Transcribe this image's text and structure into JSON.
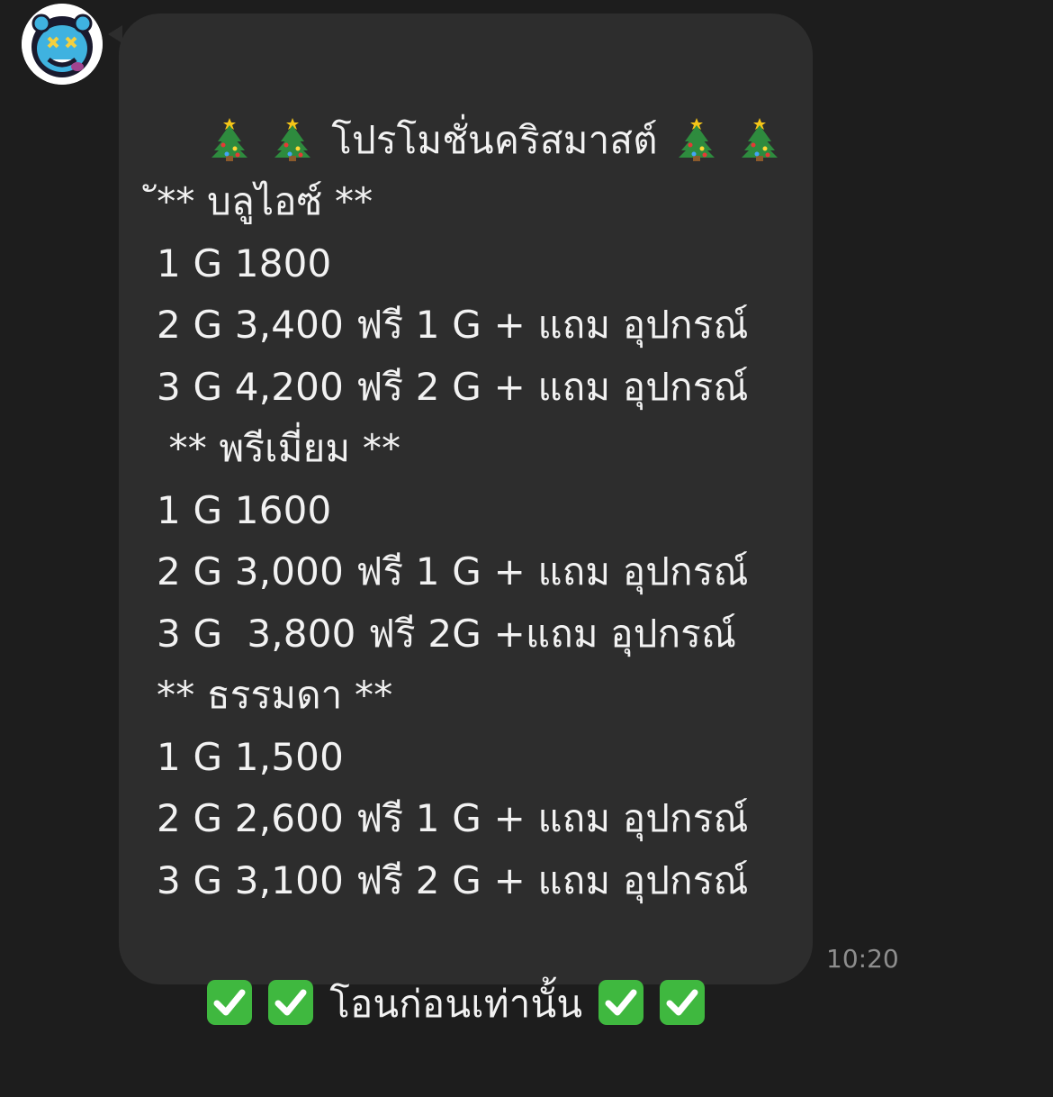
{
  "message": {
    "title_text": "โปรโมชั่นคริสมาสต์",
    "title_left_icons": [
      "christmas-tree-icon",
      "christmas-tree-icon"
    ],
    "title_right_icons": [
      "christmas-tree-icon",
      "christmas-tree-icon"
    ],
    "lines": [
      "ั** บลูไอซ์ **",
      "1 G 1800",
      "2 G 3,400 ฟรี 1 G + แถม อุปกรณ์",
      "3 G 4,200 ฟรี 2 G + แถม อุปกรณ์",
      " ** พรีเมี่ยม **",
      "1 G 1600",
      "2 G 3,000 ฟรี 1 G + แถม อุปกรณ์",
      "3 G  3,800 ฟรี 2G +แถม อุปกรณ์",
      "** ธรรมดา **",
      "1 G 1,500",
      "2 G 2,600 ฟรี 1 G + แถม อุปกรณ์",
      "3 G 3,100 ฟรี 2 G + แถม อุปกรณ์"
    ],
    "footer_text": "โอนก่อนเท่านั้น",
    "footer_left_icons": [
      "check-mark-icon",
      "check-mark-icon"
    ],
    "footer_right_icons": [
      "check-mark-icon",
      "check-mark-icon"
    ],
    "time": "10:20"
  },
  "colors": {
    "background": "#1d1d1d",
    "bubble": "#2d2d2d",
    "text": "#f2f2f2",
    "timestamp": "#8e8e8e",
    "check_green": "#3fb83f"
  }
}
